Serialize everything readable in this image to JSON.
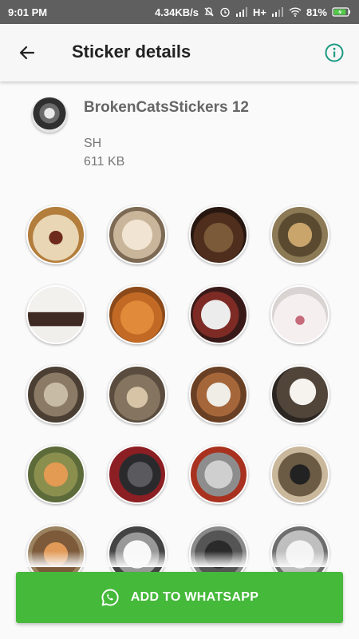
{
  "status_bar": {
    "time": "9:01 PM",
    "speed": "4.34KB/s",
    "network": "H+",
    "battery": "81%"
  },
  "app_bar": {
    "title": "Sticker details"
  },
  "pack": {
    "name": "BrokenCatsStickers 12",
    "author": "SH",
    "size": "611 KB"
  },
  "stickers": [
    "cat-sticker-1",
    "cat-sticker-2",
    "cat-sticker-3",
    "cat-sticker-4",
    "cat-sticker-5",
    "cat-sticker-6",
    "cat-sticker-7",
    "cat-sticker-8",
    "cat-sticker-9",
    "cat-sticker-10",
    "cat-sticker-11",
    "cat-sticker-12",
    "cat-sticker-13",
    "cat-sticker-14",
    "cat-sticker-15",
    "cat-sticker-16",
    "cat-sticker-17",
    "cat-sticker-18",
    "cat-sticker-19",
    "cat-sticker-20"
  ],
  "button": {
    "label": "ADD TO WHATSAPP",
    "color": "#45b93a"
  },
  "colors": {
    "accent": "#1a9a82",
    "status_bar": "#5f5f5f"
  }
}
